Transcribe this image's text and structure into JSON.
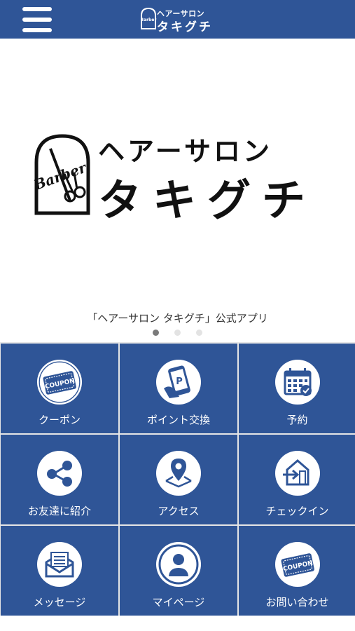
{
  "header": {
    "menu_icon": "hamburger-menu-icon",
    "logo_small_line1": "ヘアーサロン",
    "logo_small_line2": "タキグチ",
    "logo_badge_text": "Barber"
  },
  "hero": {
    "logo_line1": "ヘアーサロン",
    "logo_line2": "タキグチ",
    "badge_text": "Barber",
    "caption": "「ヘアーサロン タキグチ」公式アプリ",
    "carousel": {
      "total": 3,
      "active": 1
    }
  },
  "menu": {
    "tiles": [
      {
        "label": "クーポン",
        "icon": "coupon-icon",
        "icon_text": "COUPON"
      },
      {
        "label": "ポイント交換",
        "icon": "point-exchange-icon",
        "icon_text": "P"
      },
      {
        "label": "予約",
        "icon": "calendar-icon"
      },
      {
        "label": "お友達に紹介",
        "icon": "share-icon"
      },
      {
        "label": "アクセス",
        "icon": "map-pin-icon"
      },
      {
        "label": "チェックイン",
        "icon": "checkin-icon"
      },
      {
        "label": "メッセージ",
        "icon": "message-icon"
      },
      {
        "label": "マイページ",
        "icon": "user-icon"
      },
      {
        "label": "お問い合わせ",
        "icon": "contact-coupon-icon",
        "icon_text": "COUPON"
      }
    ]
  },
  "colors": {
    "primary": "#2f5597",
    "grid_gap": "#e6e6e6",
    "text": "#333333"
  }
}
